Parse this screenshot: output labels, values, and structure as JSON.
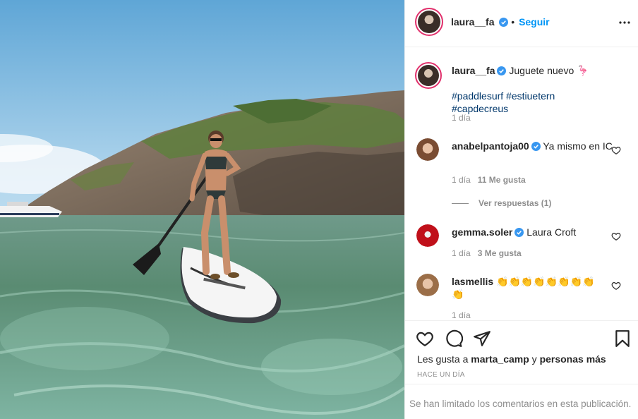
{
  "post": {
    "username": "laura__fa",
    "follow_label": "Seguir",
    "bullet": "•"
  },
  "caption": {
    "username": "laura__fa",
    "text": "Juguete nuevo",
    "emoji": "🦩",
    "hashtags": "#paddlesurf #estiuetern #capdecreus",
    "time": "1 día"
  },
  "comments": [
    {
      "username": "anabelpantoja00",
      "verified": true,
      "text": "Ya mismo en IC",
      "time": "1 día",
      "likes": "11 Me gusta"
    },
    {
      "username": "gemma.soler",
      "verified": true,
      "text": "Laura Croft",
      "time": "1 día",
      "likes": "3 Me gusta"
    },
    {
      "username": "lasmellis",
      "verified": false,
      "text": "👏👏👏👏👏👏👏👏👏",
      "time": "1 día",
      "likes": ""
    }
  ],
  "replies": {
    "label": "Ver respuestas (1)"
  },
  "likes": {
    "prefix": "Les gusta a",
    "user": "marta_camp",
    "joiner": "y",
    "others": "personas más"
  },
  "timestamp": "HACE UN DÍA",
  "comments_limited": "Se han limitado los comentarios en esta publicación.",
  "icons": [
    "more-icon",
    "heart-icon",
    "comment-icon",
    "share-icon",
    "bookmark-icon",
    "verified-icon"
  ],
  "colors": {
    "accent": "#0095f6",
    "verified": "#3897f0",
    "hashtag": "#00376b",
    "muted": "#8e8e8e"
  }
}
